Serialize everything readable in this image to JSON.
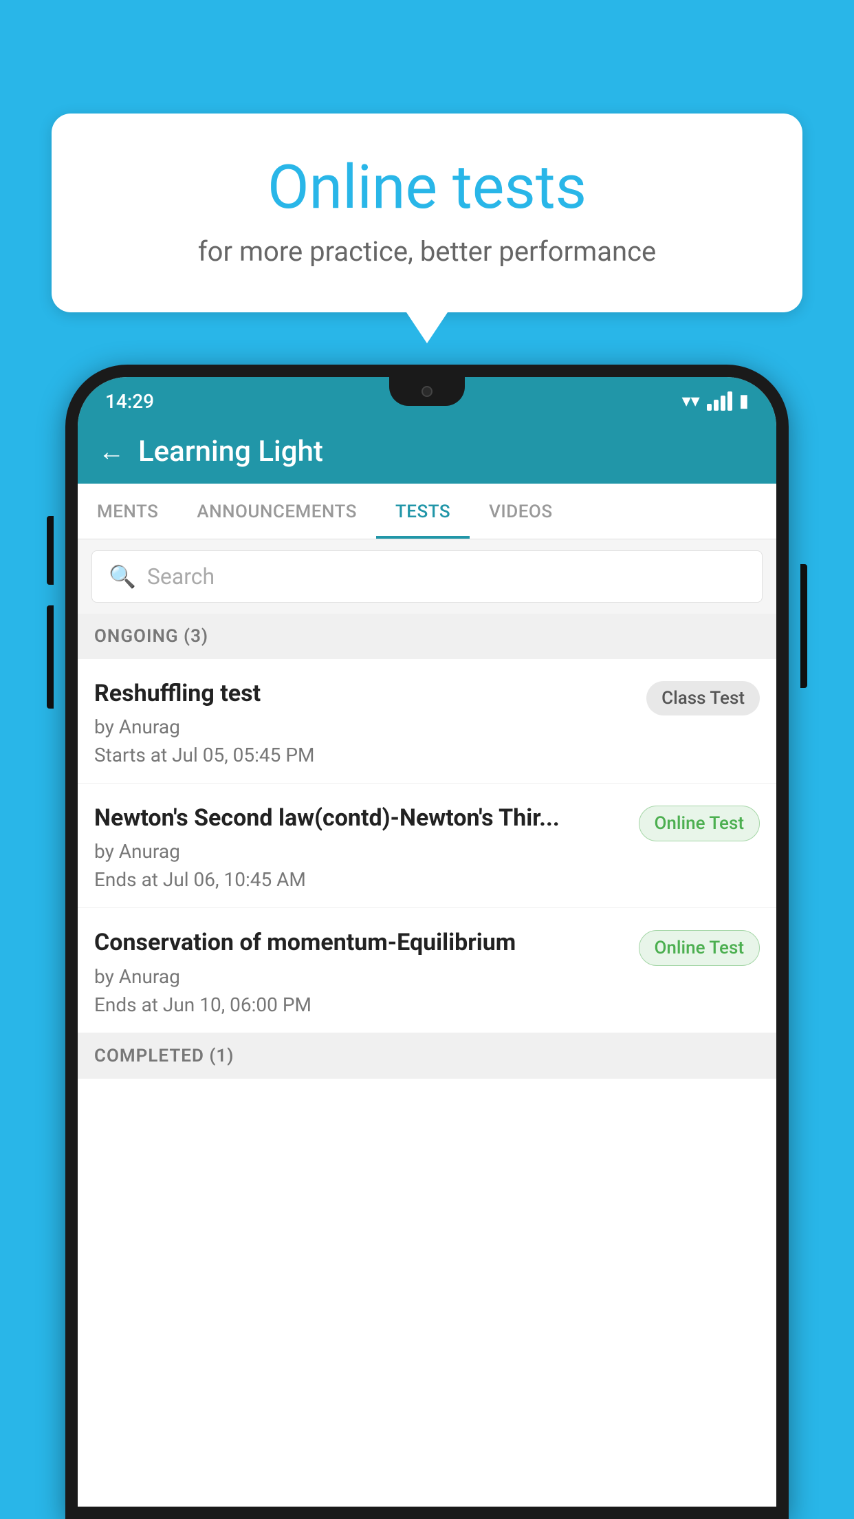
{
  "background_color": "#29b6e8",
  "speech_bubble": {
    "title": "Online tests",
    "subtitle": "for more practice, better performance"
  },
  "phone": {
    "status_bar": {
      "time": "14:29"
    },
    "header": {
      "title": "Learning Light",
      "back_label": "←"
    },
    "tabs": [
      {
        "label": "MENTS",
        "active": false
      },
      {
        "label": "ANNOUNCEMENTS",
        "active": false
      },
      {
        "label": "TESTS",
        "active": true
      },
      {
        "label": "VIDEOS",
        "active": false
      }
    ],
    "search": {
      "placeholder": "Search"
    },
    "ongoing_section": {
      "label": "ONGOING (3)"
    },
    "tests": [
      {
        "name": "Reshuffling test",
        "author": "by Anurag",
        "time_label": "Starts at",
        "time": "Jul 05, 05:45 PM",
        "badge": "Class Test",
        "badge_type": "class"
      },
      {
        "name": "Newton's Second law(contd)-Newton's Thir...",
        "author": "by Anurag",
        "time_label": "Ends at",
        "time": "Jul 06, 10:45 AM",
        "badge": "Online Test",
        "badge_type": "online"
      },
      {
        "name": "Conservation of momentum-Equilibrium",
        "author": "by Anurag",
        "time_label": "Ends at",
        "time": "Jun 10, 06:00 PM",
        "badge": "Online Test",
        "badge_type": "online"
      }
    ],
    "completed_section": {
      "label": "COMPLETED (1)"
    }
  }
}
